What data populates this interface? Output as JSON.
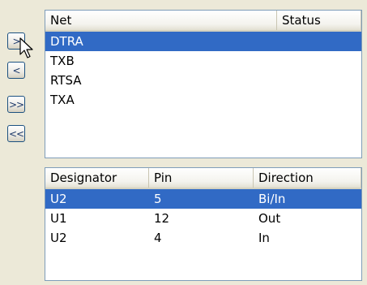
{
  "nav_buttons": [
    {
      "label": ">"
    },
    {
      "label": "<"
    },
    {
      "label": ">>"
    },
    {
      "label": "<<"
    }
  ],
  "net_list": {
    "columns": [
      "Net",
      "Status"
    ],
    "rows": [
      {
        "net": "DTRA",
        "status": "",
        "selected": true
      },
      {
        "net": "TXB",
        "status": "",
        "selected": false
      },
      {
        "net": "RTSA",
        "status": "",
        "selected": false
      },
      {
        "net": "TXA",
        "status": "",
        "selected": false
      }
    ]
  },
  "pin_list": {
    "columns": [
      "Designator",
      "Pin",
      "Direction"
    ],
    "rows": [
      {
        "designator": "U2",
        "pin": "5",
        "direction": "Bi/In",
        "selected": true
      },
      {
        "designator": "U1",
        "pin": "12",
        "direction": "Out",
        "selected": false
      },
      {
        "designator": "U2",
        "pin": "4",
        "direction": "In",
        "selected": false
      }
    ]
  },
  "colors": {
    "selection": "#316ac5",
    "panel_background": "#ece9d8",
    "list_border": "#7f9db9"
  }
}
